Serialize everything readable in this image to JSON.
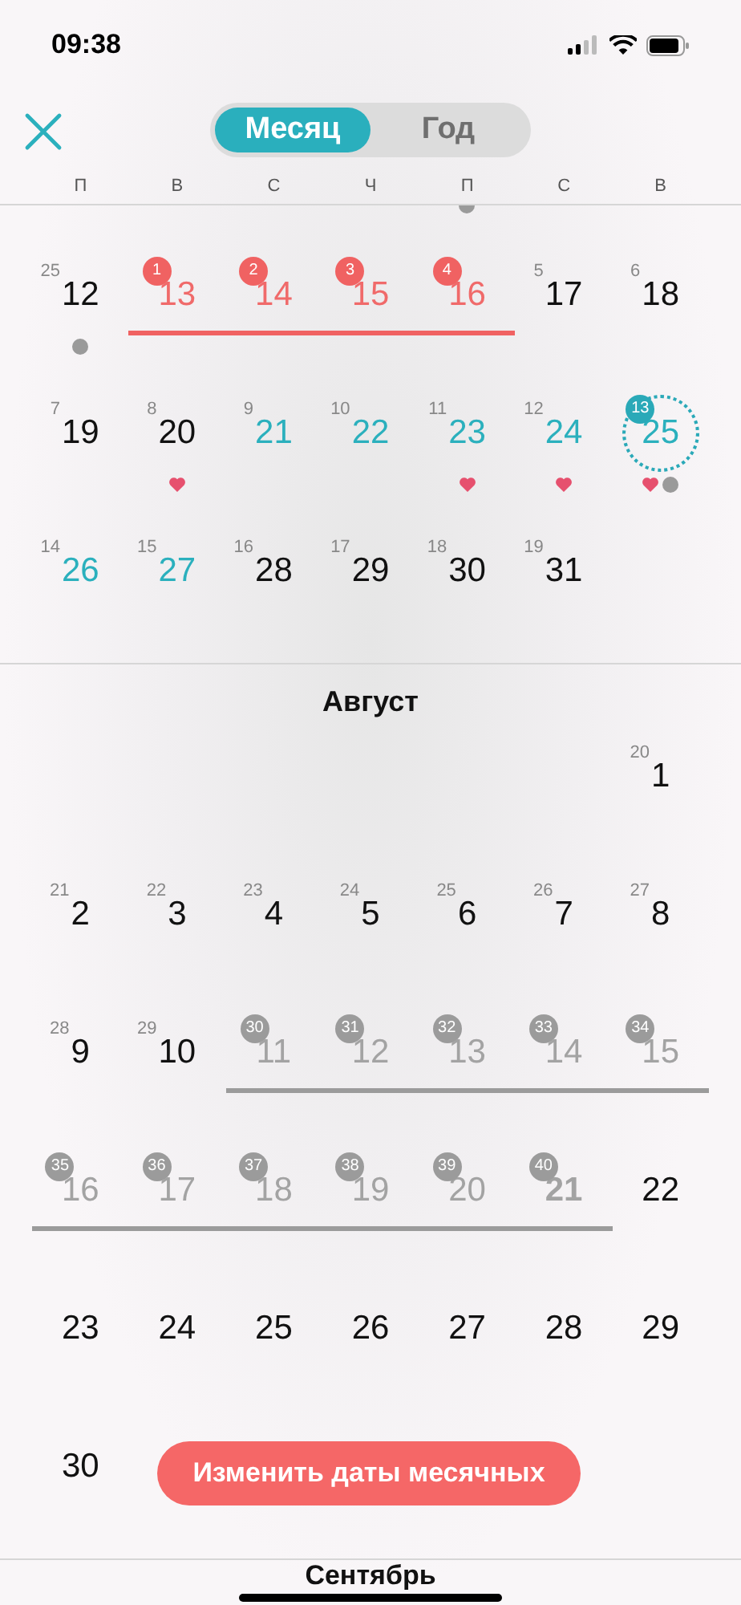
{
  "status_bar": {
    "time": "09:38"
  },
  "header": {
    "segments": [
      {
        "label": "Месяц",
        "selected": true
      },
      {
        "label": "Год",
        "selected": false
      }
    ]
  },
  "weekdays": [
    "П",
    "В",
    "С",
    "Ч",
    "П",
    "С",
    "В"
  ],
  "sections": [
    {
      "weeks": [
        [
          {
            "kind": "plain",
            "day": "12",
            "cycle_day": "25",
            "heart": false,
            "dot": true
          },
          {
            "kind": "period",
            "day": "13",
            "cycle_day": "1",
            "heart": false,
            "dot": false
          },
          {
            "kind": "period",
            "day": "14",
            "cycle_day": "2",
            "heart": false,
            "dot": false
          },
          {
            "kind": "period",
            "day": "15",
            "cycle_day": "3",
            "heart": false,
            "dot": false
          },
          {
            "kind": "period",
            "day": "16",
            "cycle_day": "4",
            "heart": false,
            "dot": false
          },
          {
            "kind": "plain",
            "day": "17",
            "cycle_day": "5",
            "heart": false,
            "dot": false
          },
          {
            "kind": "plain",
            "day": "18",
            "cycle_day": "6",
            "heart": false,
            "dot": false
          }
        ],
        [
          {
            "kind": "plain",
            "day": "19",
            "cycle_day": "7",
            "heart": false,
            "dot": false
          },
          {
            "kind": "plain",
            "day": "20",
            "cycle_day": "8",
            "heart": true,
            "dot": false
          },
          {
            "kind": "fertile",
            "day": "21",
            "cycle_day": "9",
            "heart": false,
            "dot": false
          },
          {
            "kind": "fertile",
            "day": "22",
            "cycle_day": "10",
            "heart": false,
            "dot": false
          },
          {
            "kind": "fertile",
            "day": "23",
            "cycle_day": "11",
            "heart": true,
            "dot": false
          },
          {
            "kind": "fertile",
            "day": "24",
            "cycle_day": "12",
            "heart": true,
            "dot": false
          },
          {
            "kind": "today",
            "day": "25",
            "cycle_day": "13",
            "heart": true,
            "dot": true
          }
        ],
        [
          {
            "kind": "fertile",
            "day": "26",
            "cycle_day": "14",
            "heart": false,
            "dot": false
          },
          {
            "kind": "fertile",
            "day": "27",
            "cycle_day": "15",
            "heart": false,
            "dot": false
          },
          {
            "kind": "plain",
            "day": "28",
            "cycle_day": "16",
            "heart": false,
            "dot": false
          },
          {
            "kind": "plain",
            "day": "29",
            "cycle_day": "17",
            "heart": false,
            "dot": false
          },
          {
            "kind": "plain",
            "day": "30",
            "cycle_day": "18",
            "heart": false,
            "dot": false
          },
          {
            "kind": "plain",
            "day": "31",
            "cycle_day": "19",
            "heart": false,
            "dot": false
          },
          {
            "kind": "blank"
          }
        ]
      ]
    },
    {
      "title": "Август",
      "weeks": [
        [
          {
            "kind": "blank"
          },
          {
            "kind": "blank"
          },
          {
            "kind": "blank"
          },
          {
            "kind": "blank"
          },
          {
            "kind": "blank"
          },
          {
            "kind": "blank"
          },
          {
            "kind": "plain",
            "day": "1",
            "cycle_day": "20",
            "heart": false,
            "dot": false
          }
        ],
        [
          {
            "kind": "plain",
            "day": "2",
            "cycle_day": "21",
            "heart": false,
            "dot": false
          },
          {
            "kind": "plain",
            "day": "3",
            "cycle_day": "22",
            "heart": false,
            "dot": false
          },
          {
            "kind": "plain",
            "day": "4",
            "cycle_day": "23",
            "heart": false,
            "dot": false
          },
          {
            "kind": "plain",
            "day": "5",
            "cycle_day": "24",
            "heart": false,
            "dot": false
          },
          {
            "kind": "plain",
            "day": "6",
            "cycle_day": "25",
            "heart": false,
            "dot": false
          },
          {
            "kind": "plain",
            "day": "7",
            "cycle_day": "26",
            "heart": false,
            "dot": false
          },
          {
            "kind": "plain",
            "day": "8",
            "cycle_day": "27",
            "heart": false,
            "dot": false
          }
        ],
        [
          {
            "kind": "plain",
            "day": "9",
            "cycle_day": "28",
            "heart": false,
            "dot": false
          },
          {
            "kind": "plain",
            "day": "10",
            "cycle_day": "29",
            "heart": false,
            "dot": false
          },
          {
            "kind": "predicted",
            "day": "11",
            "cycle_day": "30",
            "heart": false,
            "dot": false
          },
          {
            "kind": "predicted",
            "day": "12",
            "cycle_day": "31",
            "heart": false,
            "dot": false
          },
          {
            "kind": "predicted",
            "day": "13",
            "cycle_day": "32",
            "heart": false,
            "dot": false
          },
          {
            "kind": "predicted",
            "day": "14",
            "cycle_day": "33",
            "heart": false,
            "dot": false
          },
          {
            "kind": "predicted",
            "day": "15",
            "cycle_day": "34",
            "heart": false,
            "dot": false
          }
        ],
        [
          {
            "kind": "predicted",
            "day": "16",
            "cycle_day": "35",
            "heart": false,
            "dot": false
          },
          {
            "kind": "predicted",
            "day": "17",
            "cycle_day": "36",
            "heart": false,
            "dot": false
          },
          {
            "kind": "predicted",
            "day": "18",
            "cycle_day": "37",
            "heart": false,
            "dot": false
          },
          {
            "kind": "predicted",
            "day": "19",
            "cycle_day": "38",
            "heart": false,
            "dot": false
          },
          {
            "kind": "predicted",
            "day": "20",
            "cycle_day": "39",
            "heart": false,
            "dot": false
          },
          {
            "kind": "predicted_peak",
            "day": "21",
            "cycle_day": "40",
            "heart": false,
            "dot": false
          },
          {
            "kind": "plain",
            "day": "22",
            "heart": false,
            "dot": false
          }
        ],
        [
          {
            "kind": "plain",
            "day": "23",
            "heart": false,
            "dot": false
          },
          {
            "kind": "plain",
            "day": "24",
            "heart": false,
            "dot": false
          },
          {
            "kind": "plain",
            "day": "25",
            "heart": false,
            "dot": false
          },
          {
            "kind": "plain",
            "day": "26",
            "heart": false,
            "dot": false
          },
          {
            "kind": "plain",
            "day": "27",
            "heart": false,
            "dot": false
          },
          {
            "kind": "plain",
            "day": "28",
            "heart": false,
            "dot": false
          },
          {
            "kind": "plain",
            "day": "29",
            "heart": false,
            "dot": false
          }
        ],
        [
          {
            "kind": "plain",
            "day": "30",
            "heart": false,
            "dot": false
          },
          {
            "kind": "blank"
          },
          {
            "kind": "blank"
          },
          {
            "kind": "blank"
          },
          {
            "kind": "blank"
          },
          {
            "kind": "blank"
          },
          {
            "kind": "blank"
          }
        ]
      ]
    },
    {
      "title": "Сентябрь"
    }
  ],
  "action_button": {
    "label": "Изменить даты месячных"
  }
}
